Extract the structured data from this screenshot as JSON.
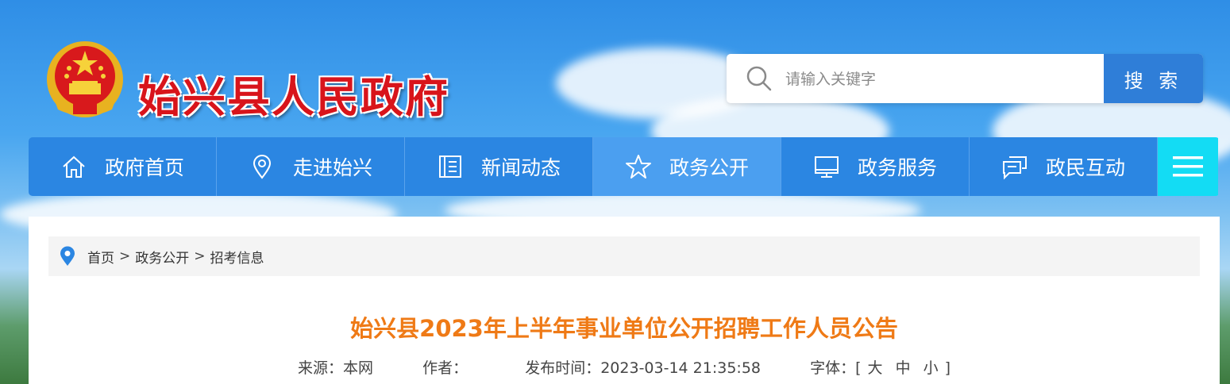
{
  "site": {
    "title": "始兴县人民政府"
  },
  "search": {
    "placeholder": "请输入关键字",
    "button_label": "搜 索"
  },
  "nav": {
    "items": [
      {
        "label": "政府首页",
        "icon": "home-icon"
      },
      {
        "label": "走进始兴",
        "icon": "location-icon"
      },
      {
        "label": "新闻动态",
        "icon": "news-icon"
      },
      {
        "label": "政务公开",
        "icon": "star-icon",
        "active": true
      },
      {
        "label": "政务服务",
        "icon": "monitor-icon"
      },
      {
        "label": "政民互动",
        "icon": "chat-icon"
      }
    ],
    "menu_icon": "menu-icon"
  },
  "breadcrumb": {
    "items": [
      "首页",
      "政务公开",
      "招考信息"
    ],
    "separator": ">"
  },
  "article": {
    "title": "始兴县2023年上半年事业单位公开招聘工作人员公告",
    "source_label": "来源：",
    "source": "本网",
    "author_label": "作者：",
    "author": "",
    "date_label": "发布时间：",
    "date": "2023-03-14 21:35:58",
    "font_label": "字体：",
    "font_open": "[",
    "font_sizes": [
      "大",
      "中",
      "小"
    ],
    "font_close": "]"
  },
  "colors": {
    "nav_bg": "#2b86e2",
    "nav_active": "#4b9ff0",
    "menu_bg": "#13dcf4",
    "title_red": "#d8141b",
    "article_title": "#ef7a16"
  }
}
